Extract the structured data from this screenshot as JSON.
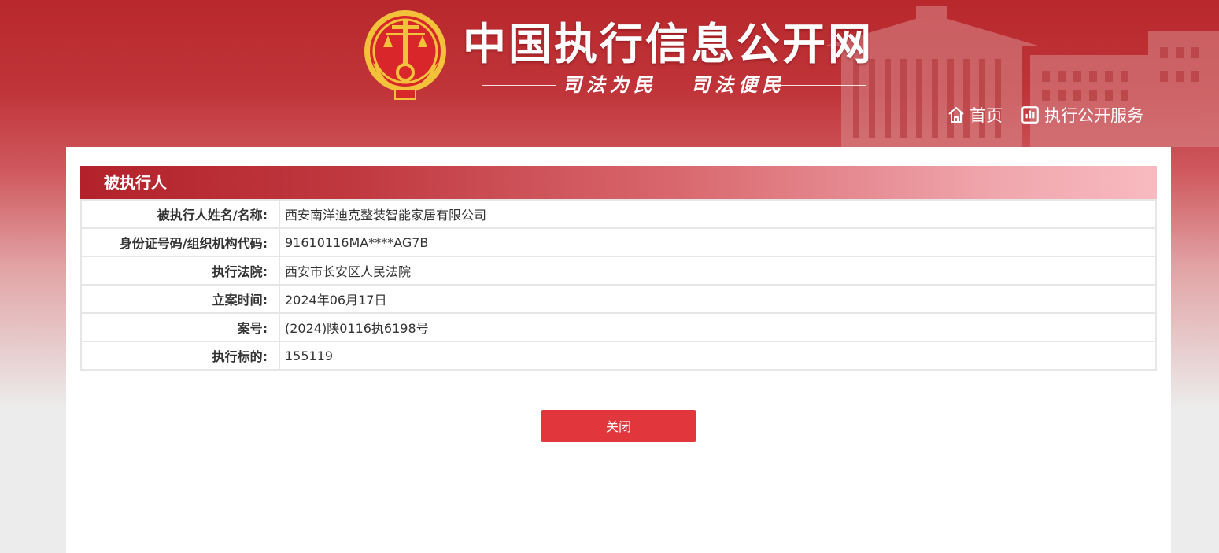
{
  "header": {
    "site_title": "中国执行信息公开网",
    "slogan": "司法为民   司法便民",
    "emblem_icon": "national-court-emblem-icon",
    "nav": [
      {
        "label": "首页",
        "icon": "home-icon"
      },
      {
        "label": "执行公开服务",
        "icon": "bar-chart-icon"
      }
    ]
  },
  "section": {
    "title": "被执行人"
  },
  "details": [
    {
      "label": "被执行人姓名/名称:",
      "value": "西安南洋迪克整装智能家居有限公司"
    },
    {
      "label": "身份证号码/组织机构代码:",
      "value": "91610116MA****AG7B"
    },
    {
      "label": "执行法院:",
      "value": "西安市长安区人民法院"
    },
    {
      "label": "立案时间:",
      "value": "2024年06月17日"
    },
    {
      "label": "案号:",
      "value": "(2024)陕0116执6198号"
    },
    {
      "label": "执行标的:",
      "value": "155119"
    }
  ],
  "actions": {
    "close_label": "关闭"
  },
  "colors": {
    "brand_red": "#b8282c",
    "button_red": "#e1373c",
    "emblem_gold": "#f2c23a"
  }
}
